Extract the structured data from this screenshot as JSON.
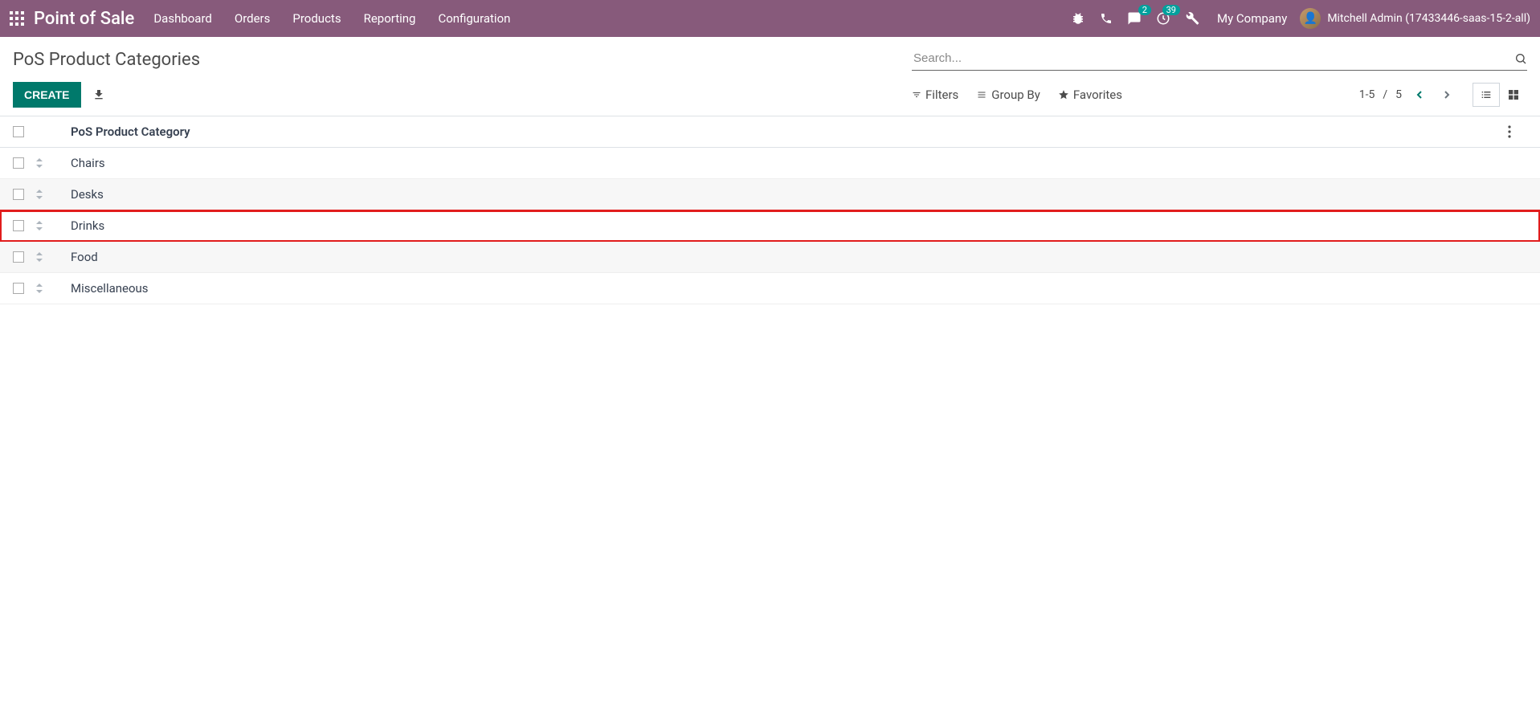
{
  "nav": {
    "brand": "Point of Sale",
    "items": [
      "Dashboard",
      "Orders",
      "Products",
      "Reporting",
      "Configuration"
    ],
    "messages_badge": "2",
    "activities_badge": "39",
    "company": "My Company",
    "user": "Mitchell Admin (17433446-saas-15-2-all)"
  },
  "cp": {
    "breadcrumb": "PoS Product Categories",
    "search_placeholder": "Search...",
    "create_label": "CREATE",
    "filters_label": "Filters",
    "groupby_label": "Group By",
    "favorites_label": "Favorites",
    "pager_value": "1-5",
    "pager_sep": "/",
    "pager_total": "5"
  },
  "table": {
    "header": "PoS Product Category",
    "rows": [
      {
        "name": "Chairs"
      },
      {
        "name": "Desks"
      },
      {
        "name": "Drinks"
      },
      {
        "name": "Food"
      },
      {
        "name": "Miscellaneous"
      }
    ],
    "highlighted_index": 2
  }
}
